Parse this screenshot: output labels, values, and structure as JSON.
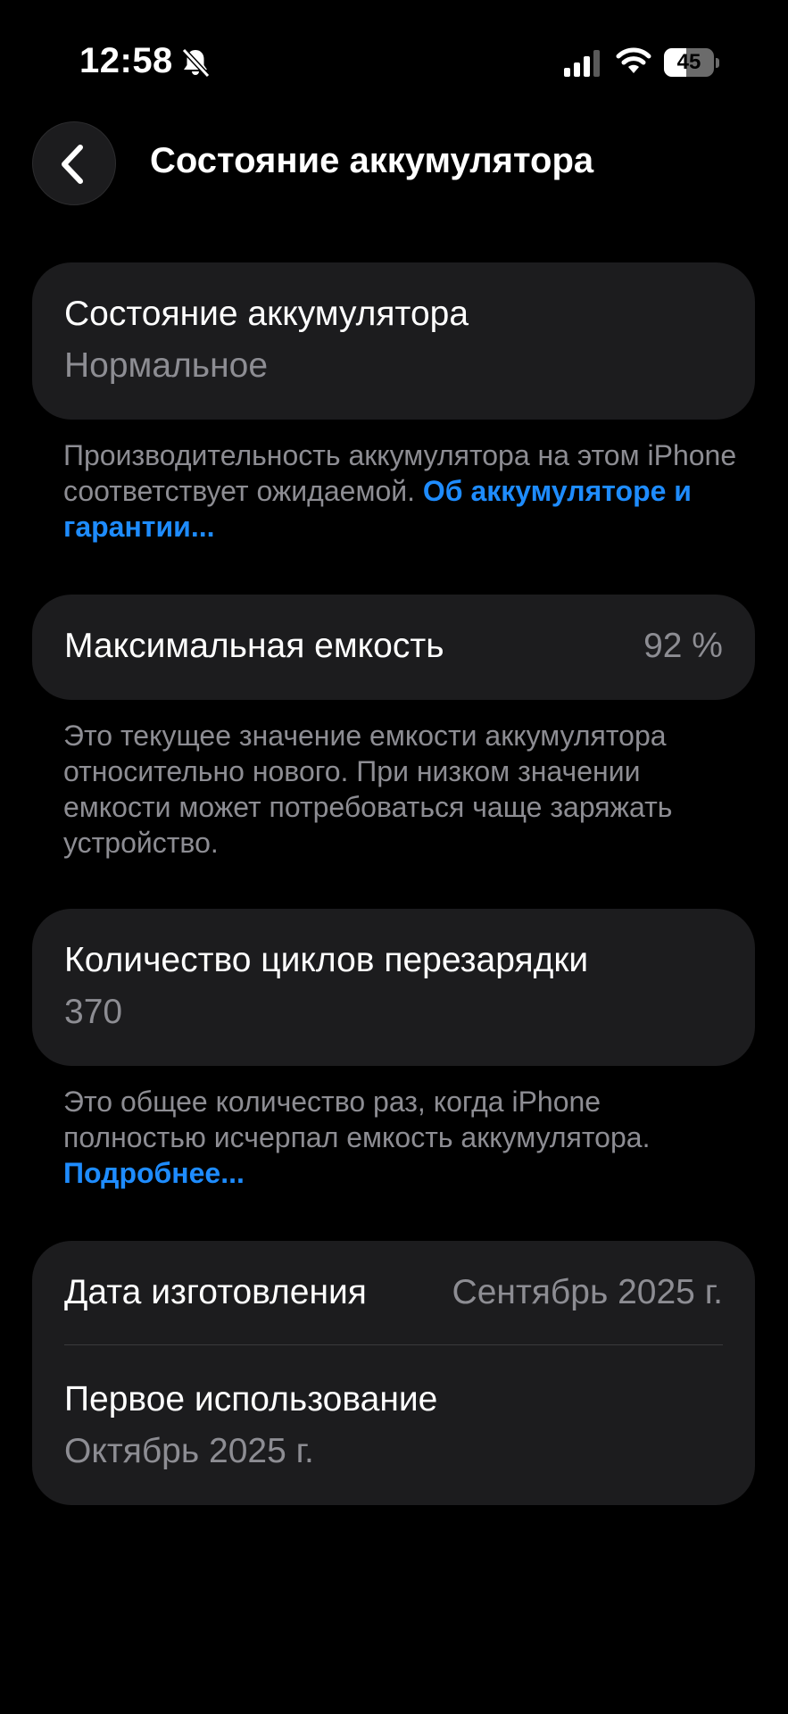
{
  "status_bar": {
    "time": "12:58",
    "battery_level": "45",
    "battery_fraction": 0.45,
    "icons": [
      "bell-slash-icon",
      "cellular-signal-icon",
      "wifi-icon",
      "battery-icon"
    ]
  },
  "nav": {
    "back_icon": "chevron-left-icon",
    "title": "Состояние аккумулятора"
  },
  "health": {
    "title": "Состояние аккумулятора",
    "value": "Нормальное",
    "footnote_text": "Производительность аккумулятора на этом iPhone соответствует ожидаемой.",
    "footnote_link": "Об аккумуляторе и гарантии..."
  },
  "capacity": {
    "label": "Максимальная емкость",
    "value": "92 %",
    "footnote": "Это текущее значение емкости аккумулятора относительно нового. При низком значении емкости может потребоваться чаще заряжать устройство."
  },
  "cycles": {
    "label": "Количество циклов перезарядки",
    "value": "370",
    "footnote_text": "Это общее количество раз, когда iPhone полностью исчерпал емкость аккумулятора.",
    "footnote_link": "Подробнее..."
  },
  "dates": {
    "manufacture_label": "Дата изготовления",
    "manufacture_value": "Сентябрь 2025 г.",
    "first_use_label": "Первое использование",
    "first_use_value": "Октябрь 2025 г."
  },
  "colors": {
    "background": "#000000",
    "card": "#1C1C1E",
    "secondary_text": "#8D8D93",
    "link": "#1E8CFF"
  }
}
